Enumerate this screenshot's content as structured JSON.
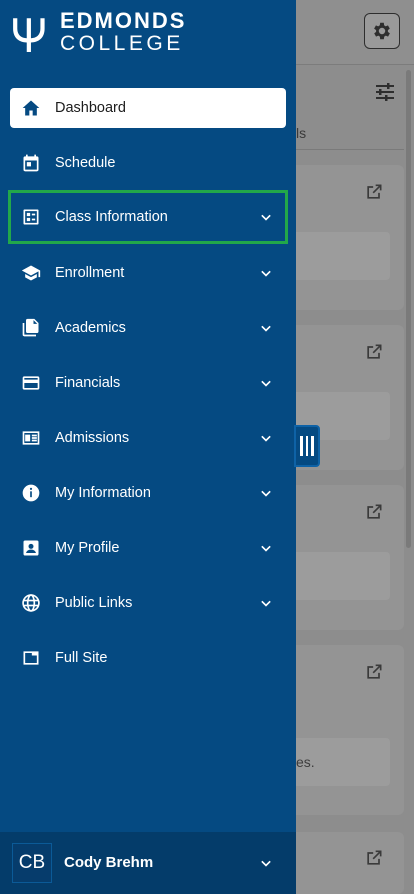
{
  "logo": {
    "line1": "EDMONDS",
    "line2": "COLLEGE"
  },
  "nav": {
    "items": [
      {
        "label": "Dashboard",
        "icon": "home-icon",
        "has_chevron": false,
        "active": true
      },
      {
        "label": "Schedule",
        "icon": "calendar-icon",
        "has_chevron": false
      },
      {
        "label": "Class Information",
        "icon": "class-list-icon",
        "has_chevron": true,
        "focused": true
      },
      {
        "label": "Enrollment",
        "icon": "graduation-cap-icon",
        "has_chevron": true
      },
      {
        "label": "Academics",
        "icon": "documents-icon",
        "has_chevron": true
      },
      {
        "label": "Financials",
        "icon": "credit-card-icon",
        "has_chevron": true
      },
      {
        "label": "Admissions",
        "icon": "newspaper-icon",
        "has_chevron": true
      },
      {
        "label": "My Information",
        "icon": "info-icon",
        "has_chevron": true
      },
      {
        "label": "My Profile",
        "icon": "profile-icon",
        "has_chevron": true
      },
      {
        "label": "Public Links",
        "icon": "globe-icon",
        "has_chevron": true
      },
      {
        "label": "Full Site",
        "icon": "window-icon",
        "has_chevron": false
      }
    ]
  },
  "user": {
    "initials": "CB",
    "name": "Cody Brehm"
  },
  "background": {
    "tab_fragment": "ls",
    "card_text_fragment": "es."
  },
  "colors": {
    "drawer": "#054a82",
    "user_bar": "#043c6a",
    "focus_outline": "#22a84a"
  }
}
